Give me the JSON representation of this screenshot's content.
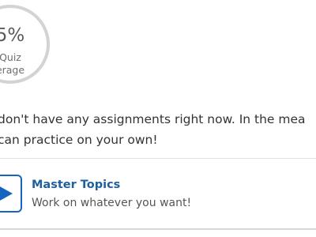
{
  "quiz": {
    "percent": "5%",
    "label_line1": "Quiz",
    "label_line2": "erage"
  },
  "message": {
    "line1": "don't have any assignments right now. In the mea",
    "line2": "can practice on your own!"
  },
  "card": {
    "title": "Master Topics",
    "subtitle": "Work on whatever you want!",
    "icon": "play-icon"
  },
  "colors": {
    "accent": "#1565c0",
    "title": "#1f5f9e",
    "ring": "#d3d3d3"
  }
}
